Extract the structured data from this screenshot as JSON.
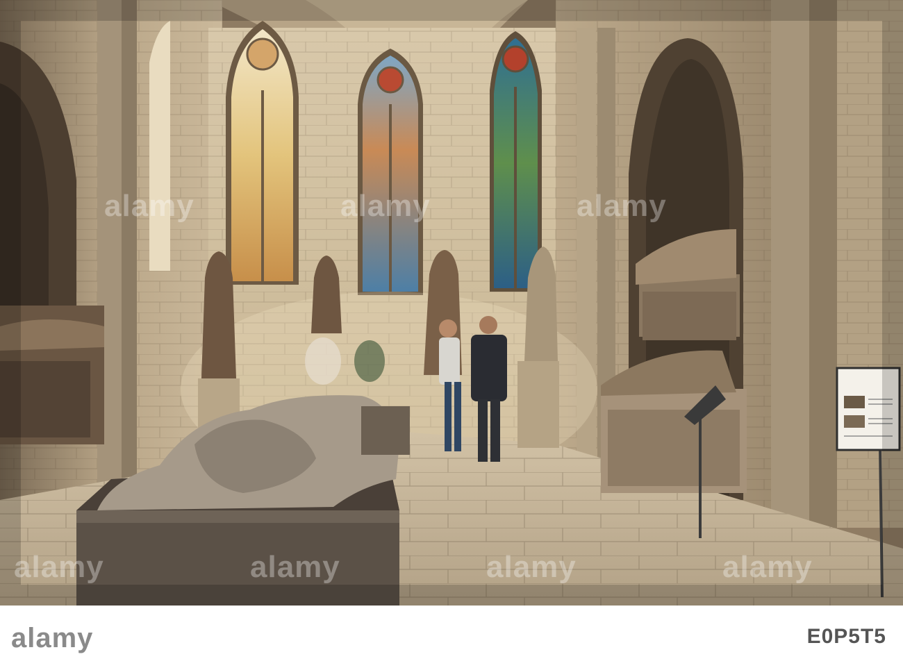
{
  "image": {
    "subject": "Gothic chapel interior with stained glass windows, medieval tomb effigies, statues and visitors",
    "colors": {
      "stone_light": "#c9b79a",
      "stone_dark": "#5e4d3a",
      "floor": "#bfae94",
      "glass_blue": "#3d6f9a",
      "glass_red": "#b0422d",
      "glass_gold": "#d9b25a"
    }
  },
  "watermark": {
    "text": "alamy"
  },
  "footer": {
    "logo": "alamy",
    "image_id": "E0P5T5"
  }
}
